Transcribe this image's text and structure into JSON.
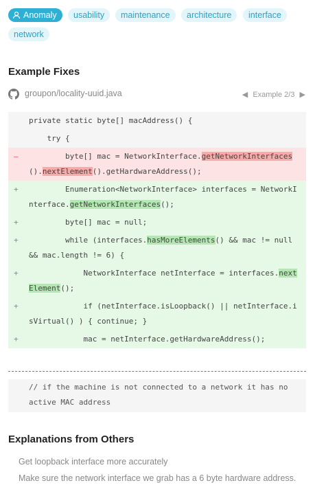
{
  "tags": [
    {
      "label": "Anomaly",
      "active": true,
      "icon": "person-icon"
    },
    {
      "label": "usability"
    },
    {
      "label": "maintenance"
    },
    {
      "label": "architecture"
    },
    {
      "label": "interface"
    },
    {
      "label": "network"
    }
  ],
  "example_fixes": {
    "heading": "Example Fixes",
    "repo": "groupon/locality-uuid.java",
    "repo_icon": "github-icon",
    "nav": {
      "prev": "◀",
      "label": "Example 2/3",
      "next": "▶"
    }
  },
  "diff": [
    {
      "type": "ctx",
      "mark": "",
      "parts": [
        {
          "t": "private static byte[] macAddress() {"
        }
      ]
    },
    {
      "type": "ctx",
      "mark": "",
      "parts": [
        {
          "t": "    try {"
        }
      ]
    },
    {
      "type": "del",
      "mark": "–",
      "parts": [
        {
          "t": "        byte[] mac = NetworkInterface."
        },
        {
          "t": "getNetworkInterfaces",
          "hl": true
        },
        {
          "t": "()."
        },
        {
          "t": "nextElement",
          "hl": true
        },
        {
          "t": "().getHardwareAddress();"
        }
      ]
    },
    {
      "type": "add",
      "mark": "+",
      "parts": [
        {
          "t": "        Enumeration<NetworkInterface> interfaces = NetworkInterface."
        },
        {
          "t": "getNetworkInterfaces",
          "hl": true
        },
        {
          "t": "();"
        }
      ]
    },
    {
      "type": "add",
      "mark": "+",
      "parts": [
        {
          "t": "        byte[] mac = null;"
        }
      ]
    },
    {
      "type": "add",
      "mark": "+",
      "parts": [
        {
          "t": "        while (interfaces."
        },
        {
          "t": "hasMoreElements",
          "hl": true
        },
        {
          "t": "() && mac != null && mac.length != 6) {"
        }
      ]
    },
    {
      "type": "add",
      "mark": "+",
      "parts": [
        {
          "t": "            NetworkInterface netInterface = interfaces."
        },
        {
          "t": "nextElement",
          "hl": true
        },
        {
          "t": "();"
        }
      ]
    },
    {
      "type": "add",
      "mark": "+",
      "parts": [
        {
          "t": "            if (netInterface.isLoopback() || netInterface.isVirtual() ) { continue; }"
        }
      ]
    },
    {
      "type": "add",
      "mark": "+",
      "parts": [
        {
          "t": "            mac = netInterface.getHardwareAddress();"
        }
      ]
    }
  ],
  "comment": "// if the machine is not connected to a network it has no active MAC address",
  "explanations": {
    "heading": "Explanations from Others",
    "items": [
      "Get loopback interface more accurately",
      "Make sure the network interface we grab has a 6 byte hardware address."
    ]
  }
}
